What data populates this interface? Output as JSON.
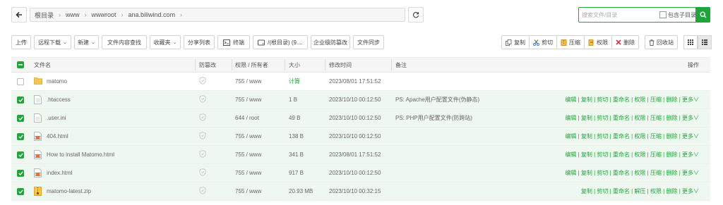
{
  "breadcrumb": [
    "根目录",
    "www",
    "wwwroot",
    "ana.biliwind.com"
  ],
  "search": {
    "placeholder": "搜索文件/目录",
    "sub_label": "包含子目录"
  },
  "toolbar": [
    {
      "label": "上传",
      "caret": false
    },
    {
      "label": "远程下载",
      "caret": true
    },
    {
      "label": "新建",
      "caret": true
    },
    {
      "label": "文件内容查找",
      "caret": false
    },
    {
      "label": "收藏夹",
      "caret": true
    },
    {
      "label": "分享列表",
      "caret": false
    },
    {
      "label": "终端",
      "caret": false
    },
    {
      "label": "/(根目录) (9....",
      "caret": false
    },
    {
      "label": "企业级防篡改",
      "caret": false
    },
    {
      "label": "文件同步",
      "caret": false
    }
  ],
  "right_tools": {
    "copy": "复制",
    "cut": "剪切",
    "compress": "压缩",
    "perm": "权限",
    "delete": "删除",
    "recycle": "回收站"
  },
  "columns": {
    "name": "文件名",
    "tamper": "防篡改",
    "perm": "权限 / 所有者",
    "size": "大小",
    "time": "修改时间",
    "note": "备注",
    "ops": "操作"
  },
  "rows": [
    {
      "name": "matomo",
      "type": "folder",
      "selected": false,
      "perm": "755 / www",
      "size": "计算",
      "time": "2023/08/01 17:51:52",
      "note": "",
      "ops": ""
    },
    {
      "name": ".htaccess",
      "type": "file",
      "selected": true,
      "perm": "755 / www",
      "size": "1 B",
      "time": "2023/10/10 00:12:50",
      "note": "PS: Apache用户配置文件(伪静态)",
      "ops": "编辑 | 复制 | 剪切 | 重命名 | 权限 | 压缩 | 删除 | 更多∨"
    },
    {
      "name": ".user.ini",
      "type": "file",
      "selected": true,
      "perm": "644 / root",
      "size": "49 B",
      "time": "2023/10/10 00:12:50",
      "note": "PS: PHP用户配置文件(防跨站)",
      "ops": "编辑 | 复制 | 剪切 | 重命名 | 权限 | 压缩 | 删除 | 更多∨"
    },
    {
      "name": "404.html",
      "type": "html",
      "selected": true,
      "perm": "755 / www",
      "size": "138 B",
      "time": "2023/10/10 00:12:50",
      "note": "",
      "ops": "编辑 | 复制 | 剪切 | 重命名 | 权限 | 压缩 | 删除 | 更多∨"
    },
    {
      "name": "How to install Matomo.html",
      "type": "html",
      "selected": true,
      "perm": "755 / www",
      "size": "341 B",
      "time": "2023/08/01 17:51:52",
      "note": "",
      "ops": "编辑 | 复制 | 剪切 | 重命名 | 权限 | 压缩 | 删除 | 更多∨"
    },
    {
      "name": "index.html",
      "type": "html",
      "selected": true,
      "perm": "755 / www",
      "size": "917 B",
      "time": "2023/10/10 00:12:50",
      "note": "",
      "ops": "编辑 | 复制 | 剪切 | 重命名 | 权限 | 压缩 | 删除 | 更多∨"
    },
    {
      "name": "matomo-latest.zip",
      "type": "zip",
      "selected": true,
      "perm": "755 / www",
      "size": "20.93 MB",
      "time": "2023/10/10 00:32:15",
      "note": "",
      "ops": "复制 | 剪切 | 重命名 | 解压 | 权限 | 删除 | 更多∨"
    }
  ],
  "colors": {
    "accent": "#20a53a",
    "selected_row": "#eef8f0"
  }
}
